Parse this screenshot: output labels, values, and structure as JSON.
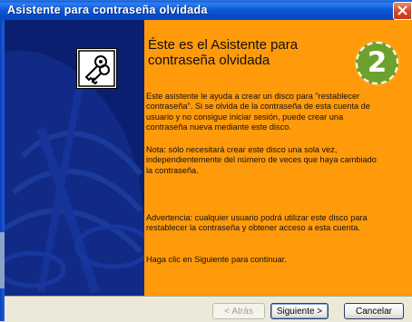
{
  "window": {
    "title": "Asistente para contraseña olvidada"
  },
  "wizard": {
    "heading": "Éste es el Asistente para contraseña olvidada",
    "intro": "Este asistente le ayuda a crear un disco para \"restablecer contraseña\". Si se olvida de la contraseña de esta cuenta de usuario y no consigue iniciar sesión, puede crear una contraseña nueva mediante este disco.",
    "note": "Nota: sólo necesitará crear este disco una sola vez, independientemente del número de veces que haya cambiado la contraseña.",
    "warning": "Advertencia: cualquier usuario podrá utilizar este disco para restablecer la contraseña y obtener acceso a esta cuenta.",
    "continue": "Haga clic en Siguiente para continuar."
  },
  "badge": {
    "number": "2"
  },
  "buttons": {
    "back": "< Atrás",
    "next": "Siguiente >",
    "cancel": "Cancelar"
  },
  "icons": {
    "wizard": "keys-icon",
    "close": "close-icon"
  },
  "colors": {
    "titlebar": "#0a58d6",
    "side_panel": "#0a1e6c",
    "content_background": "#ff9a0a",
    "badge": "#6da12d",
    "close_button": "#d2472a"
  }
}
